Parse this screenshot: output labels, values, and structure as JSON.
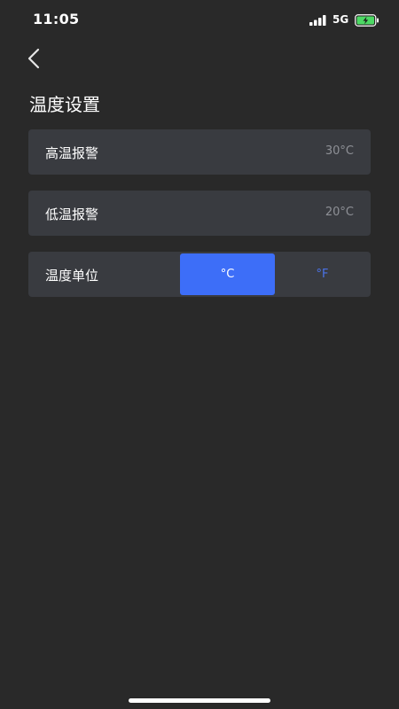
{
  "status_bar": {
    "time": "11:05",
    "network": "5G",
    "signal_icon": "signal-bars-icon",
    "battery_icon": "battery-charging-icon"
  },
  "nav": {
    "back_icon": "chevron-left-icon"
  },
  "page": {
    "title": "温度设置"
  },
  "settings": {
    "high_alarm": {
      "label": "高温报警",
      "value": "30°C"
    },
    "low_alarm": {
      "label": "低温报警",
      "value": "20°C"
    },
    "unit": {
      "label": "温度单位",
      "options": [
        "°C",
        "°F"
      ],
      "selected": "°C"
    }
  },
  "colors": {
    "background": "#292929",
    "card": "#393b40",
    "accent": "#3d6ef8",
    "secondary_text": "#8e9096",
    "battery_green": "#4cd964"
  }
}
